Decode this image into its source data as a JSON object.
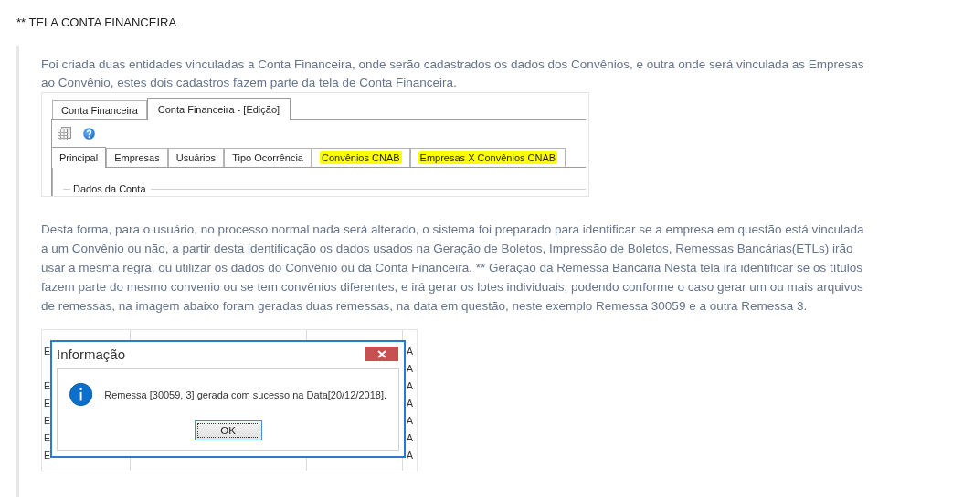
{
  "heading": "** TELA CONTA FINANCEIRA",
  "intro": "Foi criada duas entidades vinculadas a Conta Financeira, onde serão cadastrados os dados dos Convênios, e outra onde será vinculada as Empresas ao Convênio, estes dois cadastros fazem parte da tela de Conta Financeira.",
  "screenshot_1": {
    "window_tabs": [
      {
        "label": "Conta Financeira",
        "selected": false
      },
      {
        "label": "Conta Financeira - [Edição]",
        "selected": true
      }
    ],
    "tabs": [
      {
        "label": "Principal",
        "selected": true,
        "highlighted": false
      },
      {
        "label": "Empresas",
        "selected": false,
        "highlighted": false
      },
      {
        "label": "Usuários",
        "selected": false,
        "highlighted": false
      },
      {
        "label": "Tipo Ocorrência",
        "selected": false,
        "highlighted": false
      },
      {
        "label": "Convênios CNAB",
        "selected": false,
        "highlighted": true
      },
      {
        "label": "Empresas X Convênios CNAB",
        "selected": false,
        "highlighted": true
      }
    ],
    "group_title": "Dados da Conta"
  },
  "description": "Desta forma, para o usuário, no processo normal nada será alterado, o sistema foi preparado para identificar se a empresa em questão está vinculada a um Convênio ou não, a partir desta identificação os dados usados na Geração de Boletos, Impressão de Boletos, Remessas Bancárias(ETLs) irão usar a mesma regra, ou utilizar os dados do Convênio ou da Conta Financeira. ** Geração da Remessa Bancária Nesta tela irá identificar se os títulos fazem parte do mesmo convenio ou se tem convênios diferentes, e irá gerar os lotes individuais, podendo conforme o caso gerar um ou mais arquivos de remessas, na imagem abaixo foram geradas duas remessas, na data em questão, neste exemplo Remessa 30059 e a outra Remessa 3.",
  "screenshot_2": {
    "table_rows": [
      {
        "column_1": "E",
        "column_4": "A"
      },
      {
        "column_4": "A"
      },
      {
        "column_1": "E",
        "column_4": "A"
      },
      {
        "column_1": "E",
        "column_4": "A"
      },
      {
        "column_1": "E",
        "column_4": "A"
      },
      {
        "column_1": "E",
        "column_4": "A"
      },
      {
        "column_1": "E",
        "column_4": "A"
      }
    ],
    "dialog": {
      "title": "Informação",
      "message": "Remessa [30059, 3] gerada com sucesso na Data[20/12/2018].",
      "button": "OK"
    }
  }
}
